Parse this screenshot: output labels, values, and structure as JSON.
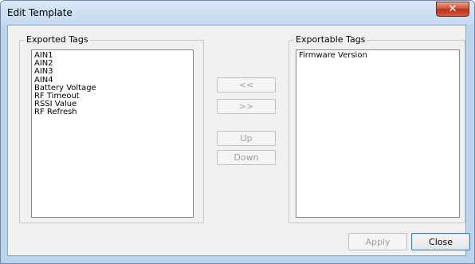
{
  "window": {
    "title": "Edit Template",
    "close_glyph": "✕"
  },
  "exported": {
    "label": "Exported Tags",
    "items": [
      "AIN1",
      "AIN2",
      "AIN3",
      "AIN4",
      "Battery Voltage",
      "RF Timeout",
      "RSSI Value",
      "RF Refresh"
    ]
  },
  "exportable": {
    "label": "Exportable Tags",
    "items": [
      "Firmware Version"
    ]
  },
  "buttons": {
    "move_left": "<<",
    "move_right": ">>",
    "up": "Up",
    "down": "Down",
    "apply": "Apply",
    "close": "Close"
  }
}
